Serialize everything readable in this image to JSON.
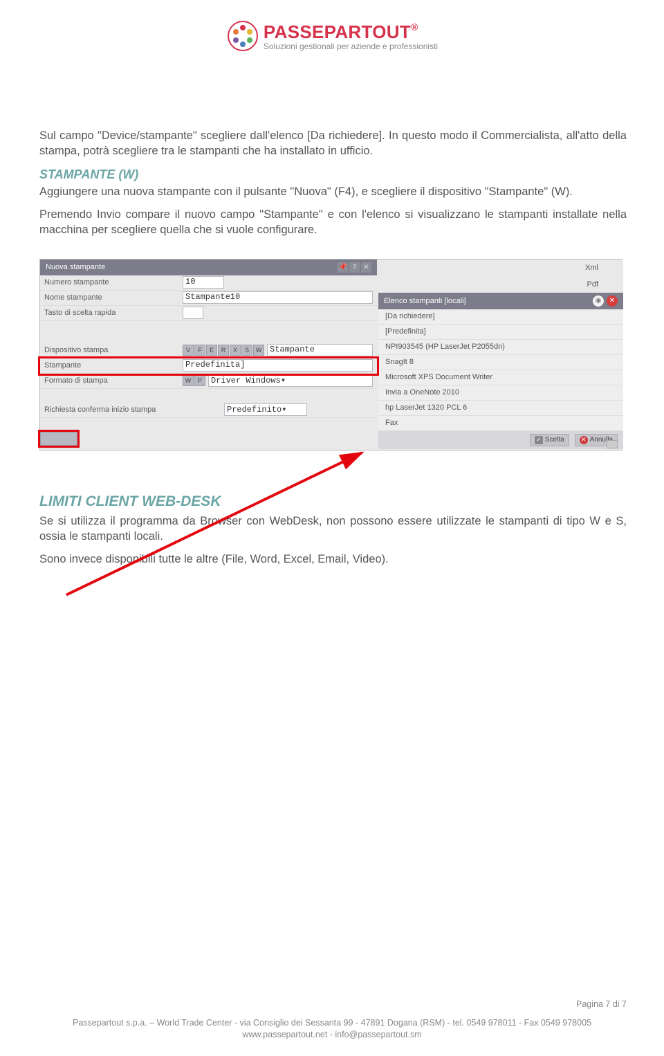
{
  "header": {
    "brand": "PASSEPARTOUT",
    "brand_suffix": "®",
    "tagline": "Soluzioni gestionali per aziende e professionisti"
  },
  "body": {
    "p1": "Sul campo \"Device/stampante\" scegliere dall'elenco [Da richiedere]. In questo modo il Commercialista, all'atto della stampa, potrà scegliere tra le stampanti che ha installato in ufficio.",
    "h_stampante": "STAMPANTE (W)",
    "p2": "Aggiungere una nuova stampante con il pulsante \"Nuova\" (F4), e scegliere il dispositivo \"Stampante\" (W).",
    "p3": "Premendo Invio compare il nuovo campo \"Stampante\" e con l'elenco si visualizzano le stampanti installate nella macchina per scegliere quella che si vuole configurare.",
    "h_limiti": "LIMITI CLIENT WEB-DESK",
    "p4": "Se si utilizza il programma da Browser con WebDesk, non possono essere utilizzate le stampanti di tipo W e S, ossia le stampanti locali.",
    "p5": "Sono invece disponibili tutte le altre (File, Word, Excel, Email, Video)."
  },
  "screenshot": {
    "window_title": "Nuova stampante",
    "rows": {
      "numero": {
        "label": "Numero stampante",
        "value": "10"
      },
      "nome": {
        "label": "Nome stampante",
        "value": "Stampante10"
      },
      "tasto": {
        "label": "Tasto di scelta rapida",
        "value": ""
      },
      "dispositivo": {
        "label": "Dispositivo stampa",
        "value": "Stampante",
        "btns": [
          "V",
          "F",
          "E",
          "R",
          "X",
          "S",
          "W"
        ]
      },
      "stampante": {
        "label": "Stampante",
        "value": "Predefinita]"
      },
      "formato": {
        "label": "Formato di stampa",
        "value": "Driver Windows▾",
        "btns": [
          "W",
          "P"
        ]
      },
      "richiesta": {
        "label": "Richiesta conferma inizio stampa",
        "value": "Predefinito▾"
      }
    },
    "right_top": [
      "Xml",
      "Pdf"
    ],
    "dropdown_header": "Elenco stampanti [locali]",
    "dropdown_items": [
      "[Da richiedere]",
      "[Predefinita]",
      "NPI903545 (HP LaserJet P2055dn)",
      "SnagIt 8",
      "Microsoft XPS Document Writer",
      "Invia a OneNote 2010",
      "hp LaserJet 1320 PCL 6",
      "Fax"
    ],
    "footer_btns": {
      "scelta": "Scelta",
      "annulla": "Annulla"
    }
  },
  "footer": {
    "page": "Pagina 7 di 7",
    "line1": "Passepartout s.p.a. – World Trade Center - via Consiglio dei Sessanta 99 - 47891 Dogana (RSM) - tel. 0549 978011 - Fax 0549 978005",
    "line2": "www.passepartout.net - info@passepartout.sm"
  }
}
